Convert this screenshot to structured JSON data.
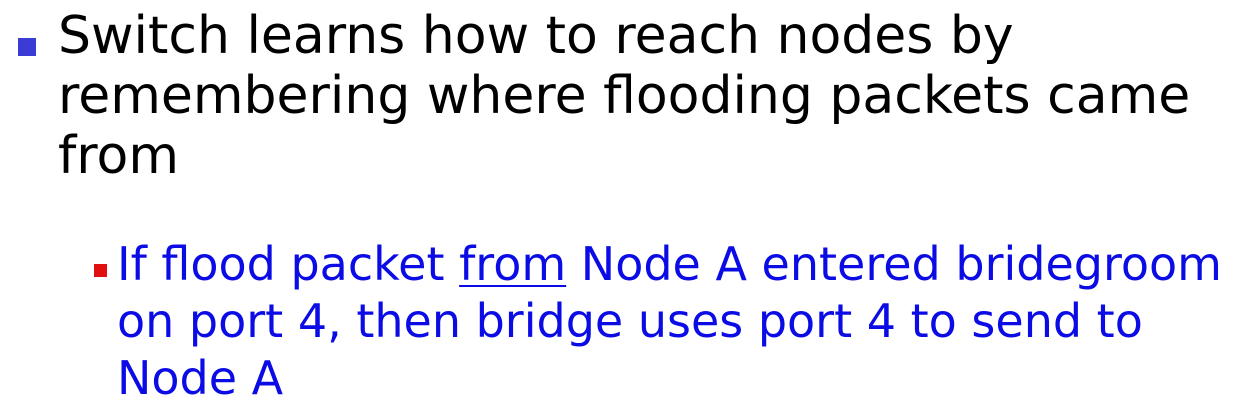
{
  "colors": {
    "level1_bullet": "#3b3bd6",
    "level1_text": "#000000",
    "level2_bullet": "#e01010",
    "level2_text": "#0b0be6"
  },
  "bullet1": {
    "line1": "Switch learns how to reach nodes by",
    "line2": "remembering where flooding packets came",
    "line3": "from"
  },
  "bullet2": {
    "line1_before": "If flood packet ",
    "line1_underlined": "from",
    "line1_after": " Node A entered bridegroom",
    "line2": "on port 4, then bridge uses port 4 to send to",
    "line3": "Node A"
  }
}
